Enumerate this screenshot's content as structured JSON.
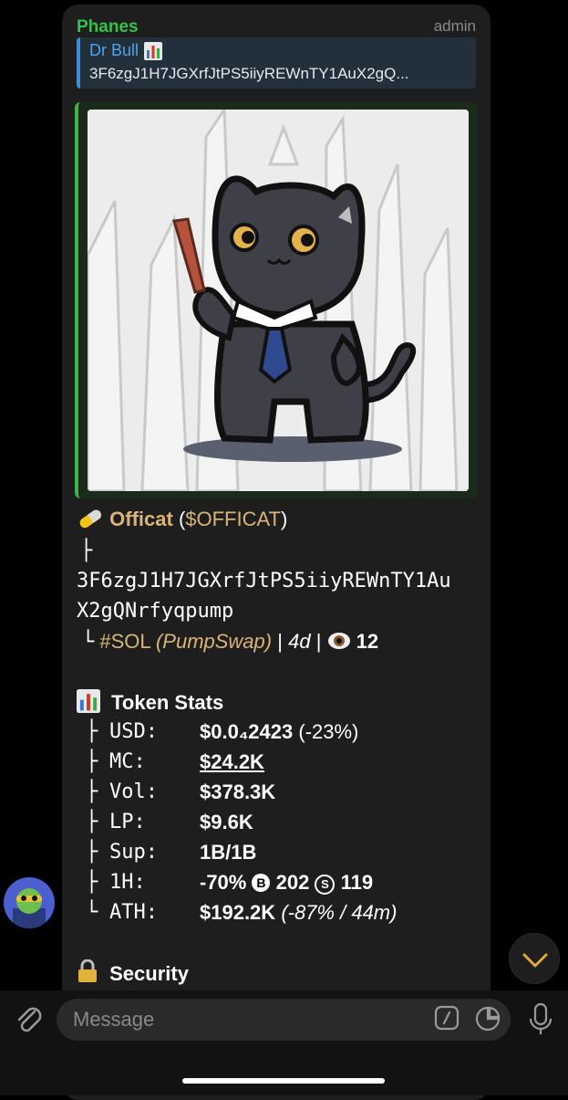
{
  "message": {
    "sender": "Phanes",
    "role": "admin",
    "reply": {
      "name": "Dr Bull",
      "icon": "bar-chart-icon",
      "text": "3F6zgJ1H7JGXrfJtPS5iiyREWnTY1AuX2gQ..."
    },
    "image": {
      "icon": "cartoon-black-cat-in-suit"
    },
    "token": {
      "pill_icon": "pill-icon",
      "name": "Officat",
      "ticker_open": "(",
      "ticker": "$OFFICAT",
      "ticker_close": ")",
      "branch1": "├",
      "address_line1": "3F6zgJ1H7JGXrfJtPS5iiyREWnTY1Au",
      "address_line2": "X2gQNrfyqpump",
      "branch2": "└",
      "chain": "#SOL",
      "dex": "(PumpSwap)",
      "sep1": "|",
      "age": "4d",
      "sep2": "|",
      "eye_icon": "eye-icon",
      "views": "12"
    },
    "stats": {
      "heading_icon": "bar-chart-icon",
      "heading": "Token Stats",
      "rows": [
        {
          "prefix": "├",
          "key": "USD:",
          "value": "$0.0₄2423",
          "extra": "(-23%)"
        },
        {
          "prefix": "├",
          "key": "MC:",
          "value": "$24.2K",
          "extra": ""
        },
        {
          "prefix": "├",
          "key": "Vol:",
          "value": "$378.3K",
          "extra": ""
        },
        {
          "prefix": "├",
          "key": "LP:",
          "value": "$9.6K",
          "extra": ""
        },
        {
          "prefix": "├",
          "key": "Sup:",
          "value": "1B/1B",
          "extra": ""
        },
        {
          "prefix": "├",
          "key": "1H:",
          "value": "-70%",
          "b_label": "B",
          "b_count": "202",
          "s_label": "S",
          "s_count": "119"
        },
        {
          "prefix": "└",
          "key": "ATH:",
          "value": "$192.2K",
          "extra": "(-87% / 44m)"
        }
      ]
    },
    "security": {
      "icon": "lock-icon",
      "heading": "Security"
    }
  },
  "input": {
    "placeholder": "Message"
  },
  "colors": {
    "bubble": "#1e1e1e",
    "sender": "#33c24a",
    "link_gold": "#d9b476",
    "reply_accent": "#3b8fd6",
    "media_accent": "#3eb544"
  }
}
